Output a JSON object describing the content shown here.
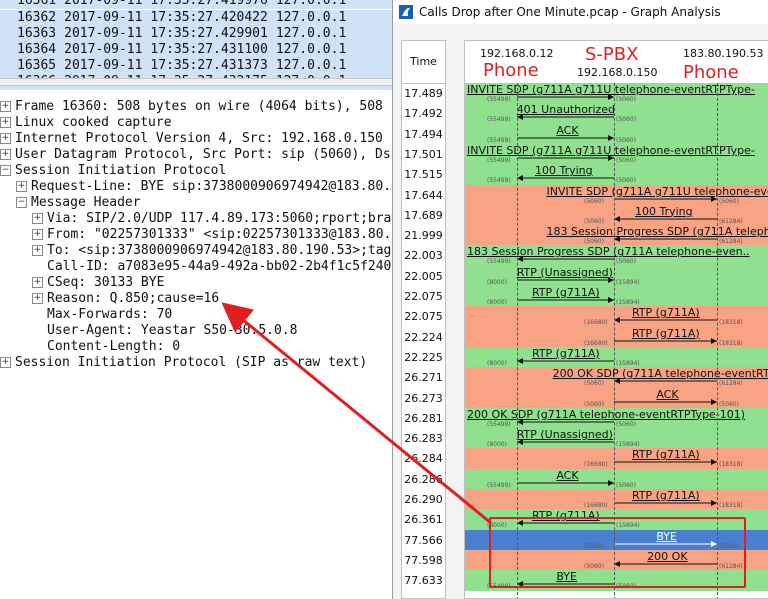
{
  "packet_list": [
    {
      "no": "16361",
      "date": "2017-09-11",
      "time": "17:35:27.419976",
      "src": "127.0.0.1"
    },
    {
      "no": "16362",
      "date": "2017-09-11",
      "time": "17:35:27.420422",
      "src": "127.0.0.1"
    },
    {
      "no": "16363",
      "date": "2017-09-11",
      "time": "17:35:27.429901",
      "src": "127.0.0.1"
    },
    {
      "no": "16364",
      "date": "2017-09-11",
      "time": "17:35:27.431100",
      "src": "127.0.0.1"
    },
    {
      "no": "16365",
      "date": "2017-09-11",
      "time": "17:35:27.431373",
      "src": "127.0.0.1"
    },
    {
      "no": "16366",
      "date": "2017-09-11",
      "time": "17:35:27.432175",
      "src": "127.0.0.1"
    }
  ],
  "details": [
    {
      "indent": 0,
      "toggle": "⊞",
      "text": "Frame 16360: 508 bytes on wire (4064 bits), 508"
    },
    {
      "indent": 0,
      "toggle": "⊞",
      "text": "Linux cooked capture"
    },
    {
      "indent": 0,
      "toggle": "⊞",
      "text": "Internet Protocol Version 4, Src: 192.168.0.150"
    },
    {
      "indent": 0,
      "toggle": "⊞",
      "text": "User Datagram Protocol, Src Port: sip (5060), Ds"
    },
    {
      "indent": 0,
      "toggle": "⊟",
      "text": "Session Initiation Protocol"
    },
    {
      "indent": 1,
      "toggle": "⊞",
      "text": "Request-Line: BYE sip:3738000906974942@183.80."
    },
    {
      "indent": 1,
      "toggle": "⊟",
      "text": "Message Header"
    },
    {
      "indent": 2,
      "toggle": "⊞",
      "text": "Via: SIP/2.0/UDP 117.4.89.173:5060;rport;bra"
    },
    {
      "indent": 2,
      "toggle": "⊞",
      "text": "From: \"02257301333\" <sip:02257301333@183.80."
    },
    {
      "indent": 2,
      "toggle": "⊞",
      "text": "To: <sip:3738000906974942@183.80.190.53>;tag"
    },
    {
      "indent": 2,
      "toggle": "",
      "text": "Call-ID: a7083e95-44a9-492a-bb02-2b4f1c5f240"
    },
    {
      "indent": 2,
      "toggle": "⊞",
      "text": "CSeq: 30133 BYE"
    },
    {
      "indent": 2,
      "toggle": "⊞",
      "text": "Reason: Q.850;cause=16"
    },
    {
      "indent": 2,
      "toggle": "",
      "text": "Max-Forwards: 70"
    },
    {
      "indent": 2,
      "toggle": "",
      "text": "User-Agent: Yeastar S50-30.5.0.8"
    },
    {
      "indent": 2,
      "toggle": "",
      "text": "Content-Length:  0"
    },
    {
      "indent": 0,
      "toggle": "⊞",
      "text": "Session Initiation Protocol (SIP as raw text)"
    }
  ],
  "window": {
    "title": "Calls Drop after One Minute.pcap - Graph Analysis",
    "time_header": "Time"
  },
  "hosts": {
    "left_ip": "192.168.0.12",
    "left_label": "Phone",
    "mid_label": "S-PBX",
    "mid_ip": "192.168.0.150",
    "right_ip": "183.80.190.53",
    "right_label": "Phone"
  },
  "colors": {
    "green": "#8fe08f",
    "salmon": "#f7a384",
    "blue": "#4a7fd0",
    "annotation": "#e02020"
  },
  "flows": [
    {
      "time": "17.489",
      "label": "INVITE SDP (g711A g711U telephone-eventRTPType-",
      "from": "A",
      "to": "B",
      "color": "green",
      "sport": "(55499)",
      "dport": "(5060)"
    },
    {
      "time": "17.492",
      "label": "401 Unauthorized",
      "from": "B",
      "to": "A",
      "color": "green",
      "sport": "(55499)",
      "dport": "(5060)"
    },
    {
      "time": "17.494",
      "label": "ACK",
      "from": "A",
      "to": "B",
      "color": "green",
      "sport": "(55499)",
      "dport": "(5060)"
    },
    {
      "time": "17.501",
      "label": "INVITE SDP (g711A g711U telephone-eventRTPType-",
      "from": "A",
      "to": "B",
      "color": "green",
      "sport": "(55499)",
      "dport": "(5060)"
    },
    {
      "time": "17.515",
      "label": "100 Trying",
      "from": "B",
      "to": "A",
      "color": "green",
      "sport": "(55499)",
      "dport": "(5060)"
    },
    {
      "time": "17.644",
      "label": "INVITE SDP (g711A g711U telephone-event",
      "from": "B",
      "to": "C",
      "color": "salmon",
      "sport": "(5060)",
      "dport": "(5060)"
    },
    {
      "time": "17.689",
      "label": "100 Trying",
      "from": "C",
      "to": "B",
      "color": "salmon",
      "sport": "(5060)",
      "dport": "(61284)"
    },
    {
      "time": "21.999",
      "label": "183 Session Progress SDP (g711A telepho",
      "from": "C",
      "to": "B",
      "color": "salmon",
      "sport": "(5060)",
      "dport": "(61284)"
    },
    {
      "time": "22.003",
      "label": "183 Session Progress SDP (g711A telephone-even..",
      "from": "B",
      "to": "A",
      "color": "green",
      "sport": "(55499)",
      "dport": "(5060)"
    },
    {
      "time": "22.005",
      "label": "RTP (Unassigned)",
      "from": "A",
      "to": "B",
      "color": "green",
      "sport": "(8000)",
      "dport": "(15894)"
    },
    {
      "time": "22.075",
      "label": "RTP (g711A)",
      "from": "A",
      "to": "B",
      "color": "green",
      "sport": "(8000)",
      "dport": "(15894)"
    },
    {
      "time": "22.075",
      "label": "RTP (g711A)",
      "from": "C",
      "to": "B",
      "color": "salmon",
      "sport": "(16680)",
      "dport": "(18318)"
    },
    {
      "time": "22.224",
      "label": "RTP (g711A)",
      "from": "B",
      "to": "C",
      "color": "salmon",
      "sport": "(16680)",
      "dport": "(18318)"
    },
    {
      "time": "22.225",
      "label": "RTP (g711A)",
      "from": "B",
      "to": "A",
      "color": "green",
      "sport": "(8000)",
      "dport": "(15894)"
    },
    {
      "time": "26.271",
      "label": "200 OK SDP (g711A telephone-eventRTPT",
      "from": "C",
      "to": "B",
      "color": "salmon",
      "sport": "(5060)",
      "dport": "(61284)"
    },
    {
      "time": "26.273",
      "label": "ACK",
      "from": "B",
      "to": "C",
      "color": "salmon",
      "sport": "(5060)",
      "dport": "(5060)"
    },
    {
      "time": "26.281",
      "label": "200 OK SDP (g711A telephone-eventRTPType-101)",
      "from": "B",
      "to": "A",
      "color": "green",
      "sport": "(55499)",
      "dport": "(5060)"
    },
    {
      "time": "26.283",
      "label": "RTP (Unassigned)",
      "from": "B",
      "to": "A",
      "color": "green",
      "sport": "(8000)",
      "dport": "(15894)"
    },
    {
      "time": "26.284",
      "label": "RTP (g711A)",
      "from": "B",
      "to": "C",
      "color": "salmon",
      "sport": "(16680)",
      "dport": "(18318)"
    },
    {
      "time": "26.286",
      "label": "ACK",
      "from": "A",
      "to": "B",
      "color": "green",
      "sport": "(55499)",
      "dport": "(5060)"
    },
    {
      "time": "26.290",
      "label": "RTP (g711A)",
      "from": "B",
      "to": "C",
      "color": "salmon",
      "sport": "(16680)",
      "dport": "(18318)"
    },
    {
      "time": "26.361",
      "label": "RTP (g711A)",
      "from": "B",
      "to": "A",
      "color": "green",
      "sport": "(8000)",
      "dport": "(15894)"
    },
    {
      "time": "77.566",
      "label": "BYE",
      "from": "B",
      "to": "C",
      "color": "blue",
      "sport": "(5060)",
      "dport": "(5060)"
    },
    {
      "time": "77.598",
      "label": "200 OK",
      "from": "C",
      "to": "B",
      "color": "salmon",
      "sport": "(5060)",
      "dport": "(61284)"
    },
    {
      "time": "77.633",
      "label": "BYE",
      "from": "B",
      "to": "A",
      "color": "green",
      "sport": "(55499)",
      "dport": "(5060)"
    }
  ]
}
